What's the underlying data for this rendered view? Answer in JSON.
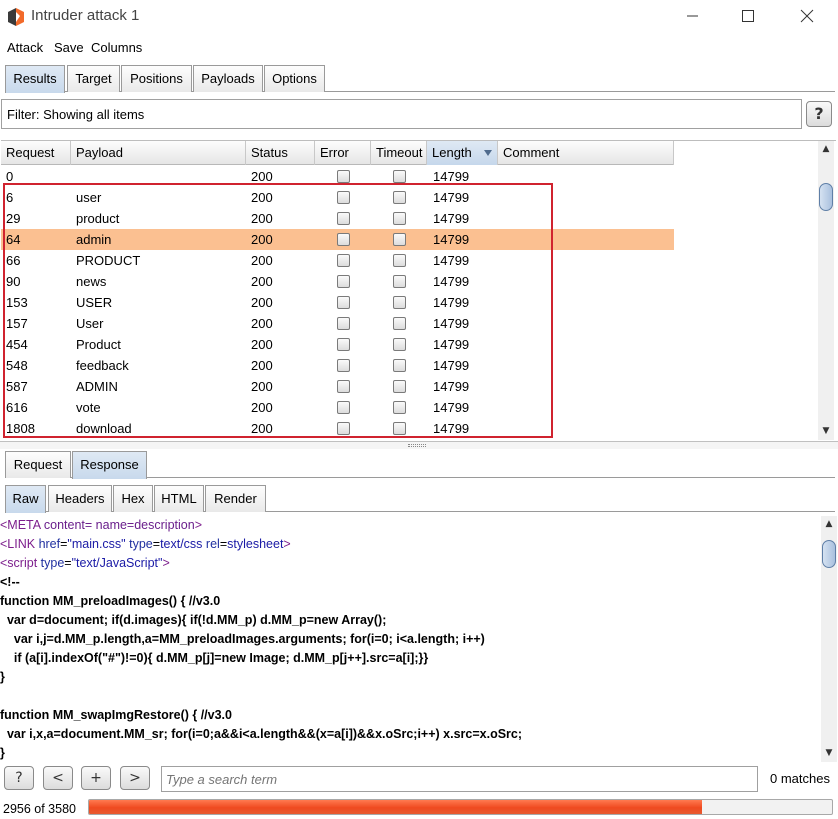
{
  "window": {
    "title": "Intruder attack 1",
    "controls": [
      "minimize-icon",
      "maximize-icon",
      "close-icon"
    ]
  },
  "menu": [
    "Attack",
    "Save",
    "Columns"
  ],
  "main_tabs": [
    {
      "label": "Results",
      "active": true
    },
    {
      "label": "Target",
      "active": false
    },
    {
      "label": "Positions",
      "active": false
    },
    {
      "label": "Payloads",
      "active": false
    },
    {
      "label": "Options",
      "active": false
    }
  ],
  "filter": {
    "text": "Filter: Showing all items",
    "help_label": "?"
  },
  "results_table": {
    "columns": [
      "Request",
      "Payload",
      "Status",
      "Error",
      "Timeout",
      "Length",
      "Comment"
    ],
    "sorted_column": "Length",
    "rows": [
      {
        "request": "0",
        "payload": "",
        "status": "200",
        "length": "14799"
      },
      {
        "request": "6",
        "payload": "user",
        "status": "200",
        "length": "14799"
      },
      {
        "request": "29",
        "payload": "product",
        "status": "200",
        "length": "14799"
      },
      {
        "request": "64",
        "payload": "admin",
        "status": "200",
        "length": "14799"
      },
      {
        "request": "66",
        "payload": "PRODUCT",
        "status": "200",
        "length": "14799"
      },
      {
        "request": "90",
        "payload": "news",
        "status": "200",
        "length": "14799"
      },
      {
        "request": "153",
        "payload": "USER",
        "status": "200",
        "length": "14799"
      },
      {
        "request": "157",
        "payload": "User",
        "status": "200",
        "length": "14799"
      },
      {
        "request": "454",
        "payload": "Product",
        "status": "200",
        "length": "14799"
      },
      {
        "request": "548",
        "payload": "feedback",
        "status": "200",
        "length": "14799"
      },
      {
        "request": "587",
        "payload": "ADMIN",
        "status": "200",
        "length": "14799"
      },
      {
        "request": "616",
        "payload": "vote",
        "status": "200",
        "length": "14799"
      },
      {
        "request": "1808",
        "payload": "download",
        "status": "200",
        "length": "14799"
      }
    ],
    "selected_request": "64",
    "highlight_color": "#d0232f",
    "selected_color": "#fbc091"
  },
  "detail_tabs": [
    {
      "label": "Request",
      "active": false
    },
    {
      "label": "Response",
      "active": true
    }
  ],
  "view_tabs": [
    {
      "label": "Raw",
      "active": true
    },
    {
      "label": "Headers",
      "active": false
    },
    {
      "label": "Hex",
      "active": false
    },
    {
      "label": "HTML",
      "active": false
    },
    {
      "label": "Render",
      "active": false
    }
  ],
  "response_lines": [
    "<META content= name=description>",
    "<LINK href=\"main.css\" type=text/css rel=stylesheet>",
    "<script type=\"text/JavaScript\">",
    "<!--",
    "function MM_preloadImages() { //v3.0",
    "  var d=document; if(d.images){ if(!d.MM_p) d.MM_p=new Array();",
    "    var i,j=d.MM_p.length,a=MM_preloadImages.arguments; for(i=0; i<a.length; i++)",
    "    if (a[i].indexOf(\"#\")!=0){ d.MM_p[j]=new Image; d.MM_p[j++].src=a[i];}}",
    "}",
    "",
    "function MM_swapImgRestore() { //v3.0",
    "  var i,x,a=document.MM_sr; for(i=0;a&&i<a.length&&(x=a[i])&&x.oSrc;i++) x.src=x.oSrc;",
    "}"
  ],
  "search": {
    "buttons": [
      "?",
      "<",
      "+",
      ">"
    ],
    "placeholder": "Type a search term",
    "matches": "0 matches"
  },
  "status": {
    "text": "2956 of 3580",
    "progress_done": 2956,
    "progress_total": 3580,
    "progress_color": "#ef4a20"
  }
}
